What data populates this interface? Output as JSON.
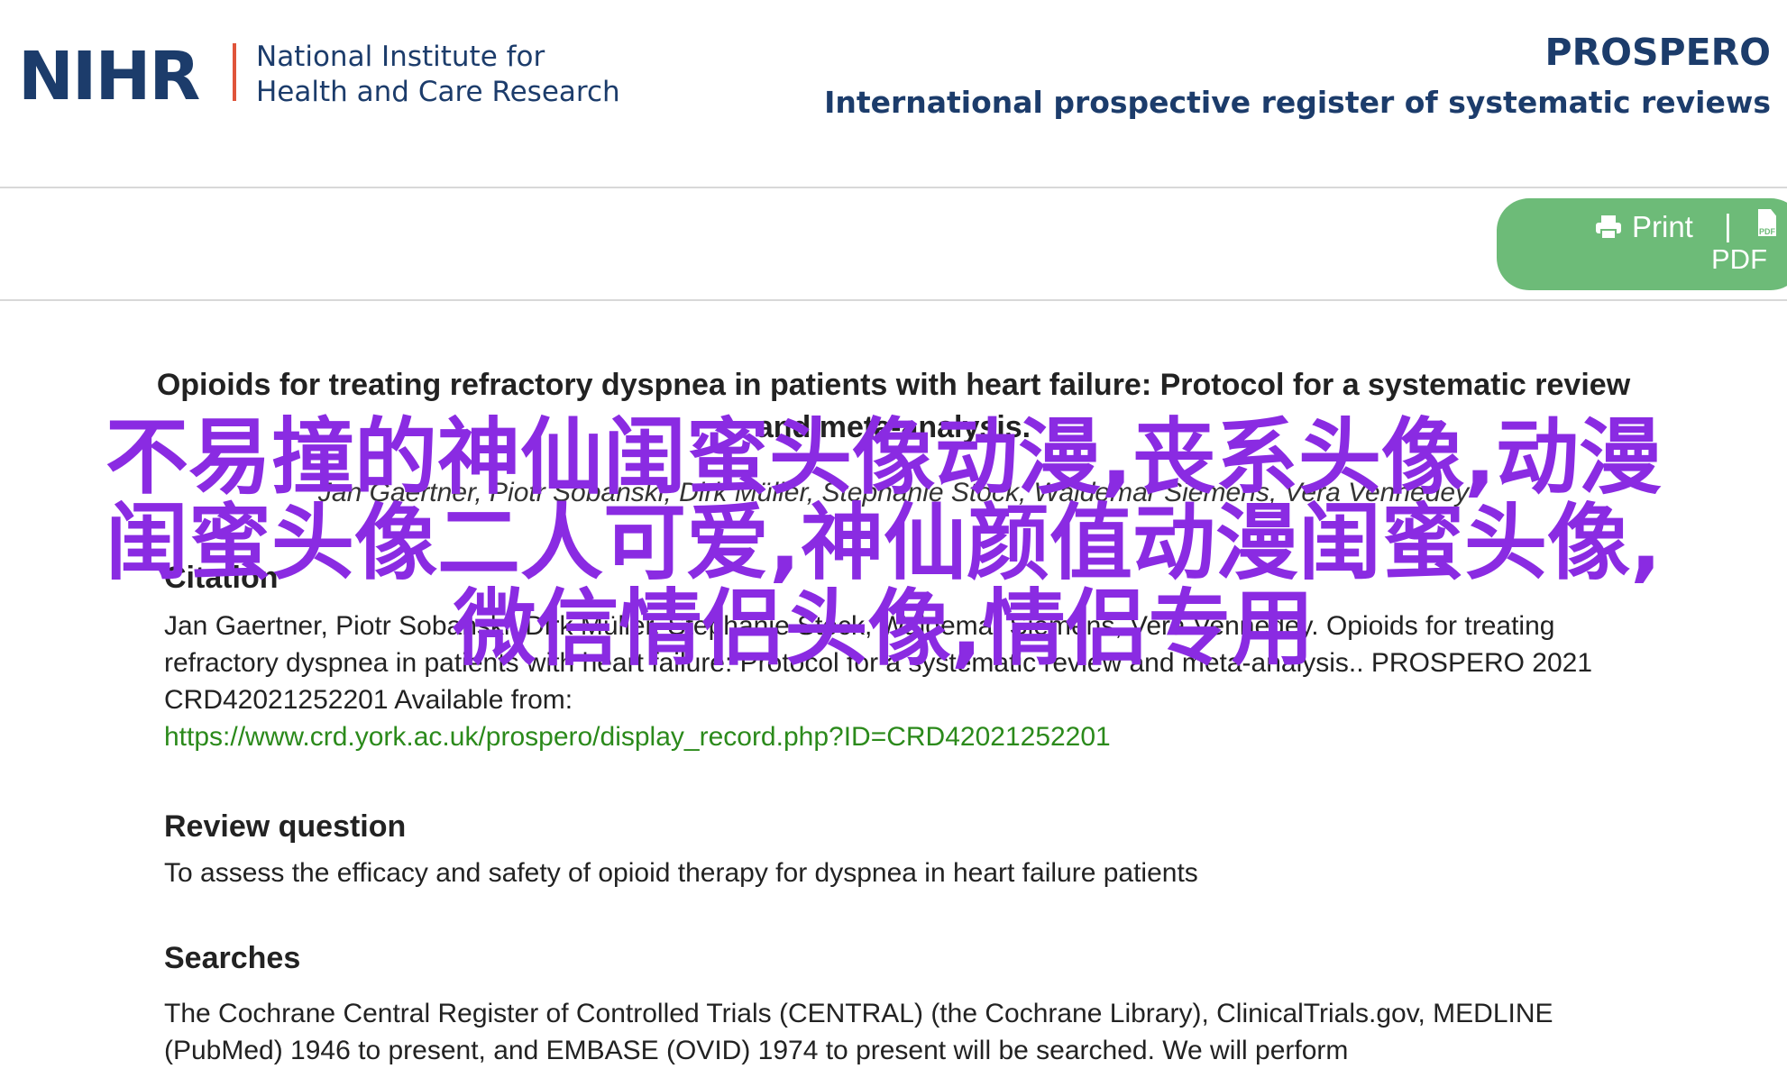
{
  "header": {
    "logo_abbr": "NIHR",
    "logo_line1": "National Institute for",
    "logo_line2": "Health and Care Research",
    "site_title": "PROSPERO",
    "site_subtitle": "International prospective register of systematic reviews"
  },
  "toolbar": {
    "print_label": "Print",
    "separator": "|",
    "pdf_label": "PDF",
    "pdf_icon_text": "PDF"
  },
  "record": {
    "title": "Opioids for treating refractory dyspnea in patients with heart failure: Protocol for a systematic review and meta-analysis.",
    "authors": "Jan Gaertner, Piotr Sobanski, Dirk Müller, Stephanie Stock, Waldemar Siemens, Vera Vennedey",
    "sections": [
      {
        "heading": "Citation",
        "text": "Jan Gaertner, Piotr Sobanski, Dirk Müller, Stephanie Stock, Waldemar Siemens, Vera Vennedey. Opioids for treating refractory dyspnea in patients with heart failure: Protocol for a systematic review and meta-analysis.. PROSPERO 2021 CRD42021252201 Available from:",
        "link": "https://www.crd.york.ac.uk/prospero/display_record.php?ID=CRD42021252201"
      },
      {
        "heading": "Review question",
        "text": "To assess the efficacy and safety of opioid therapy for dyspnea in heart failure patients"
      },
      {
        "heading": "Searches",
        "text": "The Cochrane Central Register of Controlled Trials (CENTRAL) (the Cochrane Library), ClinicalTrials.gov, MEDLINE (PubMed) 1946 to present, and EMBASE (OVID) 1974 to present will be searched. We will perform"
      }
    ]
  },
  "overlay": {
    "line1": "不易撞的神仙闺蜜头像动漫,丧系头像,动漫",
    "line2": "闺蜜头像二人可爱,神仙颜值动漫闺蜜头像,",
    "line3": "微信情侣头像,情侣专用"
  },
  "colors": {
    "brand_navy": "#1c3c6b",
    "accent_red": "#e0543a",
    "button_green": "#6dbb78",
    "link_green": "#2b8a1b",
    "overlay_purple": "#8a2be2"
  }
}
